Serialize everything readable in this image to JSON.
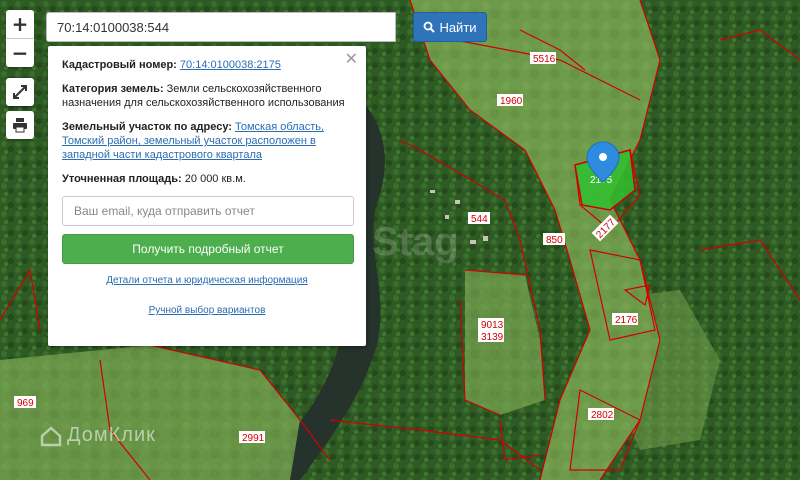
{
  "controls": {
    "zoom_in": "+",
    "zoom_out": "−"
  },
  "search": {
    "value": "70:14:0100038:544",
    "button_label": "Найти"
  },
  "info_card": {
    "cadastral_label": "Кадастровый номер:",
    "cadastral_value": "70:14:0100038:2175",
    "category_label": "Категория земель:",
    "category_value": "Земли сельскохозяйственного назначения для сельскохозяйственного использования",
    "address_label": "Земельный участок по адресу:",
    "address_value": "Томская область, Томский район, земельный участок расположен в западной части кадастрового квартала",
    "area_label": "Уточненная площадь:",
    "area_value": "20 000 кв.м.",
    "email_placeholder": "Ваш email, куда отправить отчет",
    "report_button": "Получить подробный отчет",
    "details_link": "Детали отчета и юридическая информация",
    "manual_link": "Ручной выбор вариантов"
  },
  "map": {
    "parcel_labels": [
      "5516",
      "1960",
      "2175",
      "544",
      "850",
      "2177",
      "9013",
      "3139",
      "2176",
      "2802",
      "2991",
      "969"
    ],
    "highlight_color": "#2fc12f",
    "boundary_color": "#d10000",
    "marker_color": "#2f8be0"
  },
  "watermark": {
    "brand": "ДомКлик",
    "center": "Stag"
  }
}
